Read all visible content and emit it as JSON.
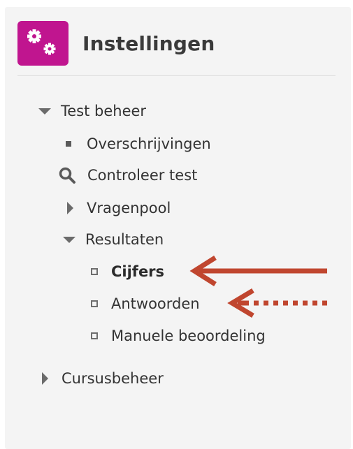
{
  "panel": {
    "title": "Instellingen",
    "logo_icon": "gears-icon",
    "accent_color": "#c0158f"
  },
  "tree": {
    "test_beheer": "Test beheer",
    "overschrijvingen": "Overschrijvingen",
    "controleer_test": "Controleer test",
    "vragenpool": "Vragenpool",
    "resultaten": "Resultaten",
    "cijfers": "Cijfers",
    "antwoorden": "Antwoorden",
    "manuele_beoordeling": "Manuele beoordeling",
    "cursusbeheer": "Cursusbeheer"
  },
  "annotations": {
    "arrow_color": "#c0462f",
    "solid_arrow_target": "Cijfers",
    "dotted_arrow_target": "Antwoorden"
  }
}
